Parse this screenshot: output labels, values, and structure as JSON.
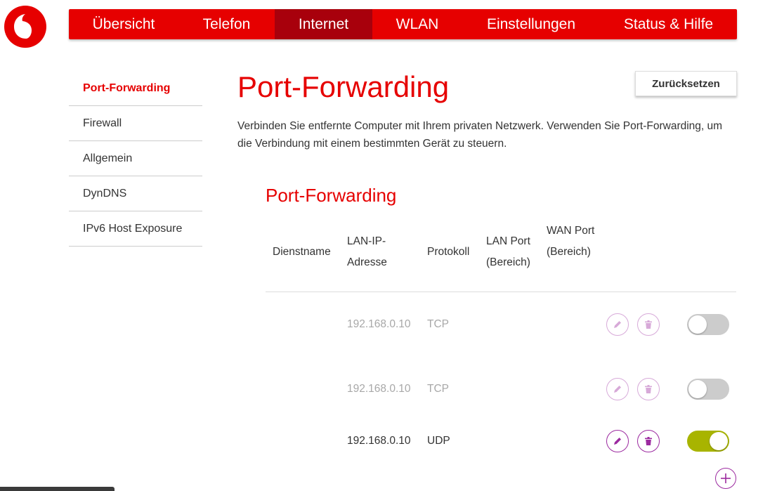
{
  "brand": {
    "logo_icon": "vodafone-speechmark-icon",
    "color": "#e60000",
    "active_nav_color": "#a8000c"
  },
  "nav": {
    "items": [
      {
        "label": "Übersicht"
      },
      {
        "label": "Telefon"
      },
      {
        "label": "Internet",
        "active": true
      },
      {
        "label": "WLAN"
      },
      {
        "label": "Einstellungen"
      },
      {
        "label": "Status & Hilfe"
      }
    ]
  },
  "sidebar": {
    "items": [
      {
        "label": "Port-Forwarding",
        "active": true
      },
      {
        "label": "Firewall"
      },
      {
        "label": "Allgemein"
      },
      {
        "label": "DynDNS"
      },
      {
        "label": "IPv6 Host Exposure"
      }
    ]
  },
  "main": {
    "title": "Port-Forwarding",
    "reset_label": "Zurücksetzen",
    "intro": "Verbinden Sie entfernte Computer mit Ihrem privaten Netzwerk. Verwenden Sie Port-Forwarding, um die Verbindung mit einem bestimmten Gerät zu steuern.",
    "section_title": "Port-Forwarding",
    "table": {
      "columns": [
        "Dienstname",
        "LAN-IP-Adresse",
        "Protokoll",
        "LAN Port (Bereich)",
        "WAN Port (Bereich)"
      ],
      "rows": [
        {
          "service": "",
          "ip": "192.168.0.10",
          "protocol": "TCP",
          "lan_port": "",
          "wan_port": "",
          "enabled": false
        },
        {
          "service": "",
          "ip": "192.168.0.10",
          "protocol": "TCP",
          "lan_port": "",
          "wan_port": "",
          "enabled": false
        },
        {
          "service": "",
          "ip": "192.168.0.10",
          "protocol": "UDP",
          "lan_port": "",
          "wan_port": "",
          "enabled": true
        }
      ]
    },
    "icons": {
      "edit": "pencil-icon",
      "delete": "trash-icon",
      "add": "plus-icon"
    },
    "accent_color": "#9c2aa0",
    "toggle_on_color": "#a8b400",
    "toggle_off_color": "#cccccc"
  }
}
